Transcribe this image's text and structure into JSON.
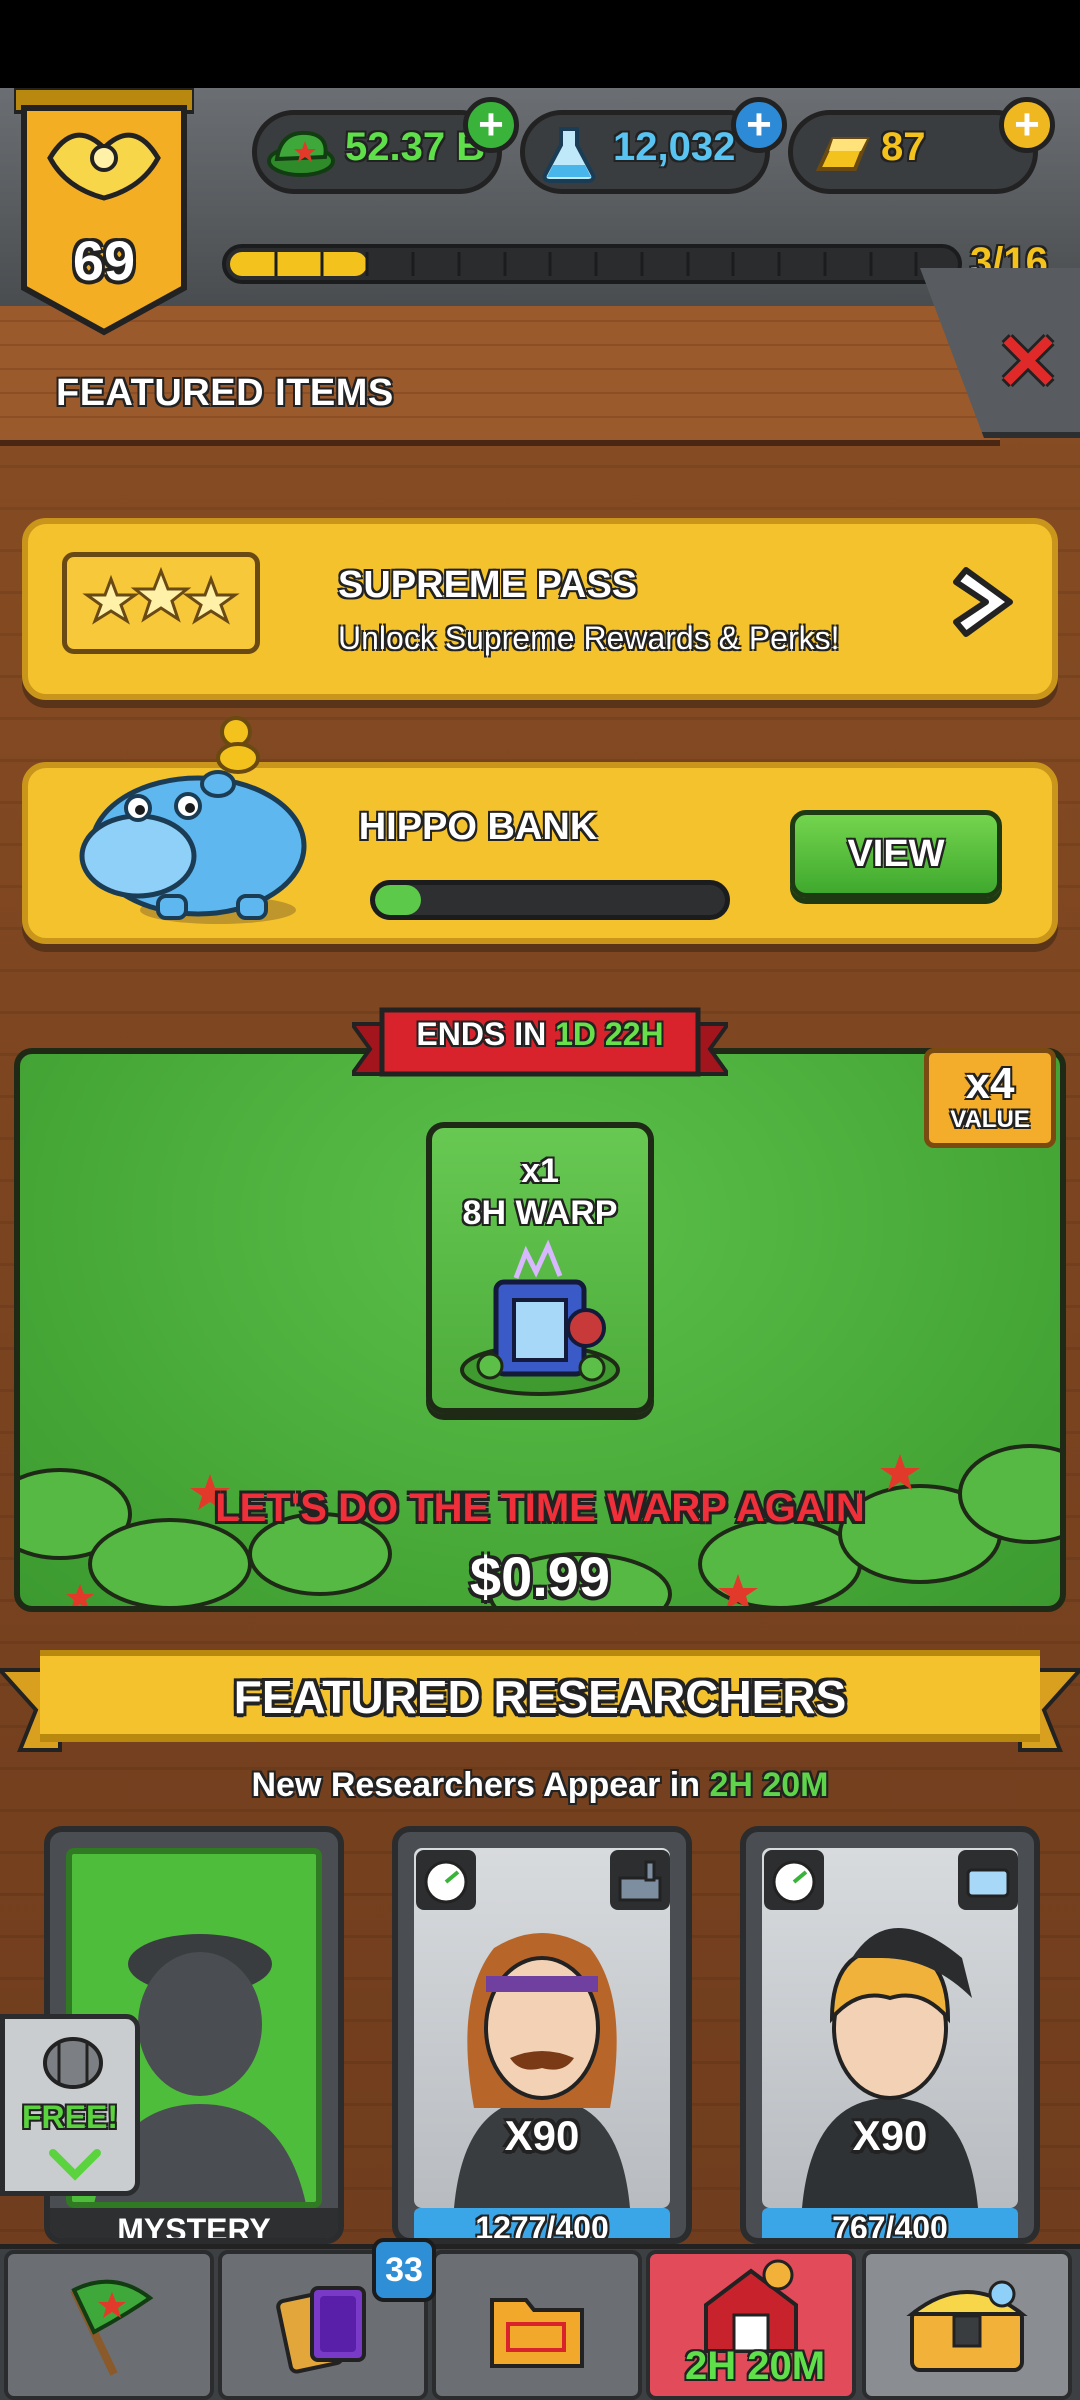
{
  "player": {
    "level": "69",
    "level_progress_label": "3/16",
    "level_progress_fraction": 0.1875
  },
  "currencies": [
    {
      "name": "cash",
      "icon": "cash-cap-icon",
      "value": "52.37 B",
      "color": "#5fe04a"
    },
    {
      "name": "science",
      "icon": "flask-icon",
      "value": "12,032",
      "color": "#59c4f2"
    },
    {
      "name": "gold",
      "icon": "gold-bar-icon",
      "value": "87",
      "color": "#f4c21c"
    }
  ],
  "header": {
    "title": "FEATURED ITEMS",
    "close_icon": "close-x-icon"
  },
  "supreme_pass": {
    "title": "SUPREME PASS",
    "subtitle": "Unlock Supreme Rewards & Perks!"
  },
  "hippo_bank": {
    "title": "HIPPO BANK",
    "button": "VIEW",
    "fill_fraction": 0.13
  },
  "offer": {
    "ends_prefix": "ENDS IN",
    "ends_time": "1D 22H",
    "value_multiplier": "x4",
    "value_label": "VALUE",
    "item_quantity": "x1",
    "item_name": "8H WARP",
    "title": "LET'S DO THE TIME WARP AGAIN",
    "price": "$0.99"
  },
  "researchers": {
    "title": "FEATURED RESEARCHERS",
    "subtitle_prefix": "New Researchers Appear in",
    "subtitle_time": "2H 20M",
    "cards": [
      {
        "label": "MYSTERY"
      },
      {
        "multiplier": "X90",
        "progress": "1277/400"
      },
      {
        "multiplier": "X90",
        "progress": "767/400"
      }
    ],
    "free_label": "FREE!"
  },
  "nav": {
    "tabs": [
      "missions",
      "cards",
      "files",
      "farm",
      "chest"
    ],
    "cards_badge": "33",
    "farm_timer": "2H 20M"
  }
}
